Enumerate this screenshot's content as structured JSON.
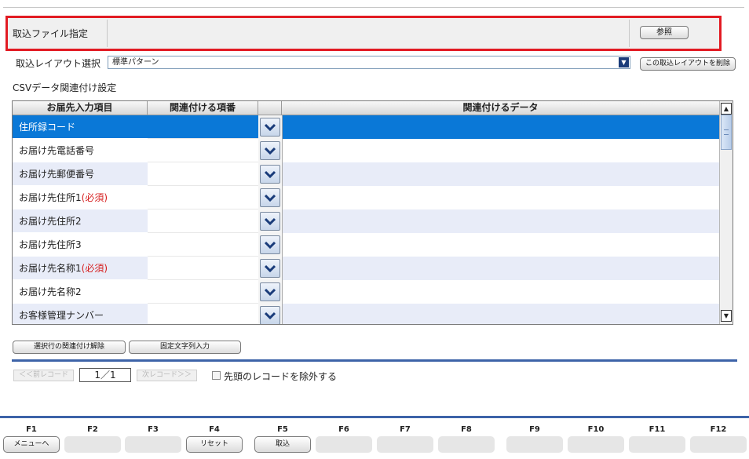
{
  "file_section": {
    "label": "取込ファイル指定",
    "browse_button": "参照"
  },
  "layout_section": {
    "label": "取込レイアウト選択",
    "selected": "標準パターン",
    "delete_button": "この取込レイアウトを削除"
  },
  "csv_section": {
    "title": "CSVデータ関連付け設定",
    "columns": [
      "お届先入力項目",
      "関連付ける項番",
      "関連付けるデータ"
    ],
    "rows": [
      {
        "item": "住所録コード",
        "required": ""
      },
      {
        "item": "お届け先電話番号",
        "required": ""
      },
      {
        "item": "お届け先郵便番号",
        "required": ""
      },
      {
        "item": "お届け先住所1",
        "required": "(必須)"
      },
      {
        "item": "お届け先住所2",
        "required": ""
      },
      {
        "item": "お届け先住所3",
        "required": ""
      },
      {
        "item": "お届け先名称1",
        "required": "(必須)"
      },
      {
        "item": "お届け先名称2",
        "required": ""
      },
      {
        "item": "お客様管理ナンバー",
        "required": ""
      }
    ]
  },
  "actions": {
    "unlink_button": "選択行の関連付け解除",
    "fixed_text_button": "固定文字列入力"
  },
  "pager": {
    "prev_button": "＜＜前レコード",
    "page": "1／1",
    "next_button": "次レコード＞＞",
    "skip_first_label": "先頭のレコードを除外する"
  },
  "fkeys": [
    {
      "key": "F1",
      "label": "メニューへ"
    },
    {
      "key": "F2",
      "label": ""
    },
    {
      "key": "F3",
      "label": ""
    },
    {
      "key": "F4",
      "label": "リセット"
    },
    {
      "key": "F5",
      "label": "取込"
    },
    {
      "key": "F6",
      "label": ""
    },
    {
      "key": "F7",
      "label": ""
    },
    {
      "key": "F8",
      "label": ""
    },
    {
      "key": "F9",
      "label": ""
    },
    {
      "key": "F10",
      "label": ""
    },
    {
      "key": "F11",
      "label": ""
    },
    {
      "key": "F12",
      "label": ""
    }
  ]
}
